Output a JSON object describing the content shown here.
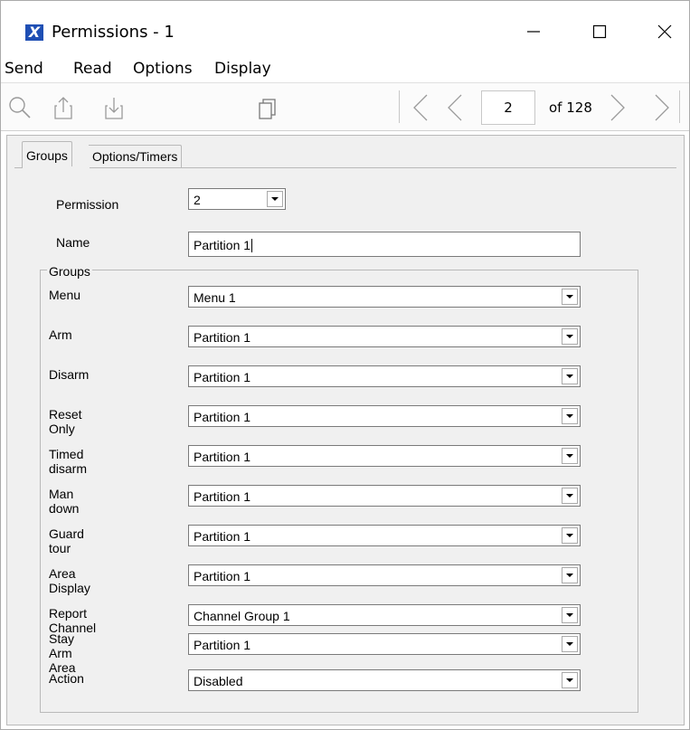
{
  "window": {
    "title": "Permissions - 1",
    "app_icon_letter": "X",
    "icons": {
      "minimize": "minimize-icon",
      "maximize": "maximize-icon",
      "close": "close-icon"
    }
  },
  "menu": [
    "Send",
    "Read",
    "Options",
    "Display"
  ],
  "toolbar": {
    "icons": [
      "search-icon",
      "upload-icon",
      "download-icon",
      "copy-icon",
      "first-record-icon",
      "previous-record-icon",
      "next-record-icon",
      "last-record-icon"
    ],
    "page_value": "2",
    "page_total": "of 128"
  },
  "tabs": [
    {
      "label": "Groups",
      "active": true
    },
    {
      "label": "Options/Timers",
      "active": false
    }
  ],
  "permission": {
    "label": "Permission",
    "value": "2"
  },
  "name": {
    "label": "Name",
    "value": "Partition 1"
  },
  "groups": {
    "title": "Groups",
    "rows": [
      {
        "label": "Menu",
        "value": "Menu 1"
      },
      {
        "label": "Arm",
        "value": "Partition 1"
      },
      {
        "label": "Disarm",
        "value": "Partition 1"
      },
      {
        "label": "Reset Only",
        "value": "Partition 1"
      },
      {
        "label": "Timed disarm",
        "value": "Partition 1"
      },
      {
        "label": "Man down",
        "value": "Partition 1"
      },
      {
        "label": "Guard tour",
        "value": "Partition 1"
      },
      {
        "label": "Area Display",
        "value": "Partition 1"
      },
      {
        "label": "Report Channel",
        "value": "Channel Group 1"
      },
      {
        "label": "Stay Arm Area",
        "value": "Partition 1"
      },
      {
        "label": "Action",
        "value": "Disabled"
      }
    ]
  },
  "colors": {
    "app_icon": "#1f4fb4",
    "panel_bg": "#f0f0f0",
    "border": "#b9b9b9"
  }
}
